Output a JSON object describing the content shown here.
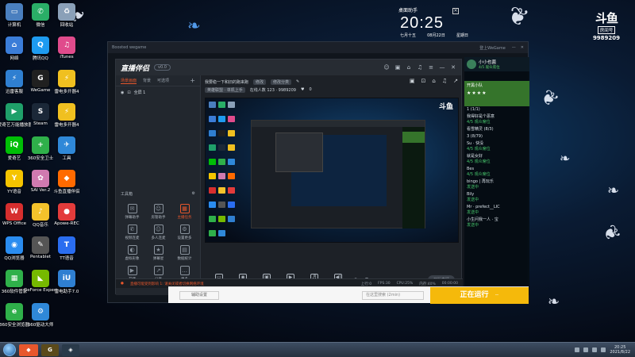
{
  "desktop": {
    "icons": [
      {
        "label": "计算机",
        "glyph": "▭",
        "color": "#4a7fbf"
      },
      {
        "label": "微信",
        "glyph": "✆",
        "color": "#2aae67"
      },
      {
        "label": "回收站",
        "glyph": "♻",
        "color": "#8aa0b8"
      },
      {
        "label": "网络",
        "glyph": "⌂",
        "color": "#3b7dd8"
      },
      {
        "label": "腾讯QQ",
        "glyph": "Q",
        "color": "#1e9bf0"
      },
      {
        "label": "iTunes",
        "glyph": "♫",
        "color": "#e04b8c"
      },
      {
        "label": "迅雷客服",
        "glyph": "⚡",
        "color": "#2f7fd1"
      },
      {
        "label": "WeGame",
        "glyph": "G",
        "color": "#202020"
      },
      {
        "label": "雷电多开器4",
        "glyph": "⚡",
        "color": "#f0c020"
      },
      {
        "label": "爱奇艺万能播放器",
        "glyph": "▶",
        "color": "#1fa06a"
      },
      {
        "label": "Steam",
        "glyph": "S",
        "color": "#1b2838"
      },
      {
        "label": "雷电多开器4",
        "glyph": "⚡",
        "color": "#f0c020"
      },
      {
        "label": "爱奇艺",
        "glyph": "iQ",
        "color": "#00be06"
      },
      {
        "label": "360安全卫士",
        "glyph": "+",
        "color": "#2fb04a"
      },
      {
        "label": "工具",
        "glyph": "✈",
        "color": "#2f88d8"
      },
      {
        "label": "YY语音",
        "glyph": "Y",
        "color": "#f5c400"
      },
      {
        "label": "SAI Ver.2",
        "glyph": "✿",
        "color": "#d07ab0"
      },
      {
        "label": "斗鱼直播伴侣",
        "glyph": "◆",
        "color": "#ff6a00"
      },
      {
        "label": "WPS Office",
        "glyph": "W",
        "color": "#d62e2e"
      },
      {
        "label": "QQ音乐",
        "glyph": "♪",
        "color": "#f4c22b"
      },
      {
        "label": "Apowe-REC",
        "glyph": "●",
        "color": "#e33b3b"
      },
      {
        "label": "QQ浏览器",
        "glyph": "◉",
        "color": "#2a8cf0"
      },
      {
        "label": "Pentablet",
        "glyph": "✎",
        "color": "#555"
      },
      {
        "label": "TT语音",
        "glyph": "T",
        "color": "#2a6df0"
      },
      {
        "label": "360软件管家",
        "glyph": "▦",
        "color": "#2fb04a"
      },
      {
        "label": "GeForce Experience",
        "glyph": "◣",
        "color": "#76b900"
      },
      {
        "label": "雷电助手7.0",
        "glyph": "iU",
        "color": "#2f7fd1"
      },
      {
        "label": "360安全浏览器",
        "glyph": "e",
        "color": "#2fb04a"
      },
      {
        "label": "360驱动大师",
        "glyph": "⚙",
        "color": "#2f88d8"
      }
    ]
  },
  "clock_widget": {
    "caption": "桌面助手",
    "time": "20:25",
    "lunar": "七月十五",
    "date": "08月22日",
    "weekday": "星期日"
  },
  "douyu": {
    "logo": "斗鱼",
    "badge": "房间号",
    "room": "9989209"
  },
  "wegame": {
    "title": "Boosted wegame",
    "user": "登上WeGame"
  },
  "live": {
    "app_name": "直播伴侣",
    "version": "v0.0",
    "scene_tabs": [
      "场景画面",
      "背景",
      "可选项"
    ],
    "scene_name": "全屏 1",
    "room_title": "我要稳一下和旧的跑来跑",
    "room_chip1": "修改",
    "room_chip2": "修改分类",
    "room_category": "英雄联盟 · 单机上手",
    "room_stats": "在线人数 123 · 9989209",
    "room_extra": "0",
    "tools_title": "工具箱",
    "tools": [
      {
        "label": "弹幕助手",
        "glyph": "✉",
        "hot": false
      },
      {
        "label": "房管助手",
        "glyph": "☺",
        "hot": false
      },
      {
        "label": "主播任务",
        "glyph": "▦",
        "hot": true
      },
      {
        "label": "视频连麦",
        "glyph": "✆",
        "hot": false
      },
      {
        "label": "多人连麦",
        "glyph": "☺",
        "hot": false
      },
      {
        "label": "设置更多",
        "glyph": "⚙",
        "hot": false
      },
      {
        "label": "虚拟形象",
        "glyph": "◐",
        "hot": false
      },
      {
        "label": "弹幕星",
        "glyph": "★",
        "hot": false
      },
      {
        "label": "数据统计",
        "glyph": "▤",
        "hot": false
      },
      {
        "label": "开播",
        "glyph": "▶",
        "hot": false
      },
      {
        "label": "分享",
        "glyph": "↗",
        "hot": false
      },
      {
        "label": "更多",
        "glyph": "…",
        "hot": false
      }
    ],
    "preview_logo": "斗鱼",
    "controls": [
      {
        "label": "直播画面",
        "glyph": "▭"
      },
      {
        "label": "摄像头",
        "glyph": "◉"
      },
      {
        "label": "多机位",
        "glyph": "▣"
      },
      {
        "label": "影视",
        "glyph": "▶"
      },
      {
        "label": "麦克风",
        "glyph": "♬"
      },
      {
        "label": "扬声器",
        "glyph": "◀)"
      }
    ],
    "start_button": "开始直播",
    "status_warning": "直播可能受到影响 1: 请关闭或者切换网络环境",
    "status_items": [
      "上行:0",
      "FPS:30",
      "CPU:25%",
      "内存:40%",
      "00:00:00"
    ]
  },
  "chat": {
    "username": "小小也菌",
    "subtitle": "4/5 观众席位",
    "banner_title": "开黑小队",
    "banner_stars": "★★★★",
    "messages": [
      {
        "user": "1 (1/1)",
        "text": ""
      },
      {
        "user": "我得好是个恶意",
        "text": "4/5 观众席位"
      },
      {
        "user": "看雪精灵 (8/3)",
        "text": ""
      },
      {
        "user": "3 (8/79)",
        "text": ""
      },
      {
        "user": "Su · 快没",
        "text": "4/5 观众席位"
      },
      {
        "user": "就是女好",
        "text": "4/5 观众席位"
      },
      {
        "user": "Bes",
        "text": "4/5 观众席位"
      },
      {
        "user": "bingo | 再玩乐",
        "text": "发送中"
      },
      {
        "user": "Bily",
        "text": "发送中"
      },
      {
        "user": "Mr · prefect__LIC",
        "text": "发送中"
      },
      {
        "user": "小生问我一人 · 宝",
        "text": "发送中"
      }
    ]
  },
  "bottom_strip": {
    "left_button": "辅助设置",
    "search_placeholder": "在这里搜索 (2min)",
    "cta": "正在运行",
    "cta_sub": "ー"
  },
  "taskbar": {
    "time": "20:25",
    "date": "2021/8/22"
  }
}
